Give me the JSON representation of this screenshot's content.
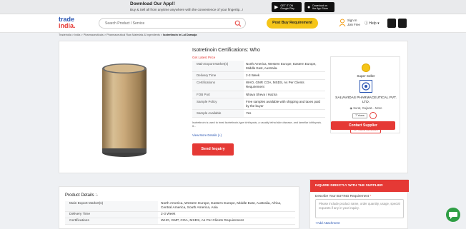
{
  "banner": {
    "title": "Download Our App!!",
    "subtitle": "Buy & Sell all from anytime anywhere with the convenience of your fingertip...!",
    "google_play": "GET IT ON Google Play",
    "app_store": "Download on the App Store"
  },
  "header": {
    "logo_top": "trade",
    "logo_bottom": "india.",
    "search_placeholder": "Search Product / Service",
    "post_buy": "Post Buy Requirement",
    "signin": "Sign In",
    "join": "Join Free",
    "help": "Help"
  },
  "breadcrumb": [
    "Tradeindia",
    "India",
    "Pharmaceuticals",
    "Pharmaceutical Raw Materials & Ingredients",
    "Isotretinoin in Lal Darwaja"
  ],
  "product": {
    "title": "Isotretinoin Certifications: Who",
    "get_price": "Get Latest Price",
    "specs": [
      {
        "k": "Main Export Market(s)",
        "v": "North America, Western Europe, Eastern Europe, Middle East, Australia."
      },
      {
        "k": "Delivery Time",
        "v": "2-3 Week"
      },
      {
        "k": "Certifications",
        "v": "WHO, GMP, COA, MSDS, As Per Clients Requirement"
      },
      {
        "k": "FOB Port",
        "v": "Nhava Sheva / Hazira"
      },
      {
        "k": "Sample Policy",
        "v": "Free samples available with shipping and taxes paid by the buyer"
      },
      {
        "k": "Sample Available",
        "v": "Yes"
      }
    ],
    "description": "Isotretinoin is used to treat Isotretinoin-type ichthyosis, a usually lethal skin disease, and lamellar ichthyosis. It...",
    "view_more": "View More Details (+)",
    "send_inquiry": "Send Inquiry"
  },
  "seller": {
    "badge": "Super Seller",
    "company": "SALVAVIDAS PHARMACEUTICAL PVT. LTD.",
    "location": "Surat, Gujarat...",
    "more": "More",
    "years": "7 Years",
    "phone": "08037303586",
    "contact": "Contact Supplier"
  },
  "details": {
    "title": "Product Details :-",
    "rows": [
      {
        "k": "Main Export Market(s)",
        "v": "North America, Western Europe, Eastern Europe, Middle East, Australia, Africa, Central America, South America, Asia"
      },
      {
        "k": "Delivery Time",
        "v": "2-3 Week"
      },
      {
        "k": "Certifications",
        "v": "WHO, GMP, COA, MSDS, As Per Clients Requirement"
      }
    ]
  },
  "inquiry": {
    "header": "INQUIRE DIRECTLY WITH THE SUPPLIER",
    "label": "Describe Your BUYING Requirement",
    "req": "*",
    "placeholder": "Please include product name, order quantity, usage, special requests if any in your inquiry.",
    "attach": "+Add Attachment"
  }
}
